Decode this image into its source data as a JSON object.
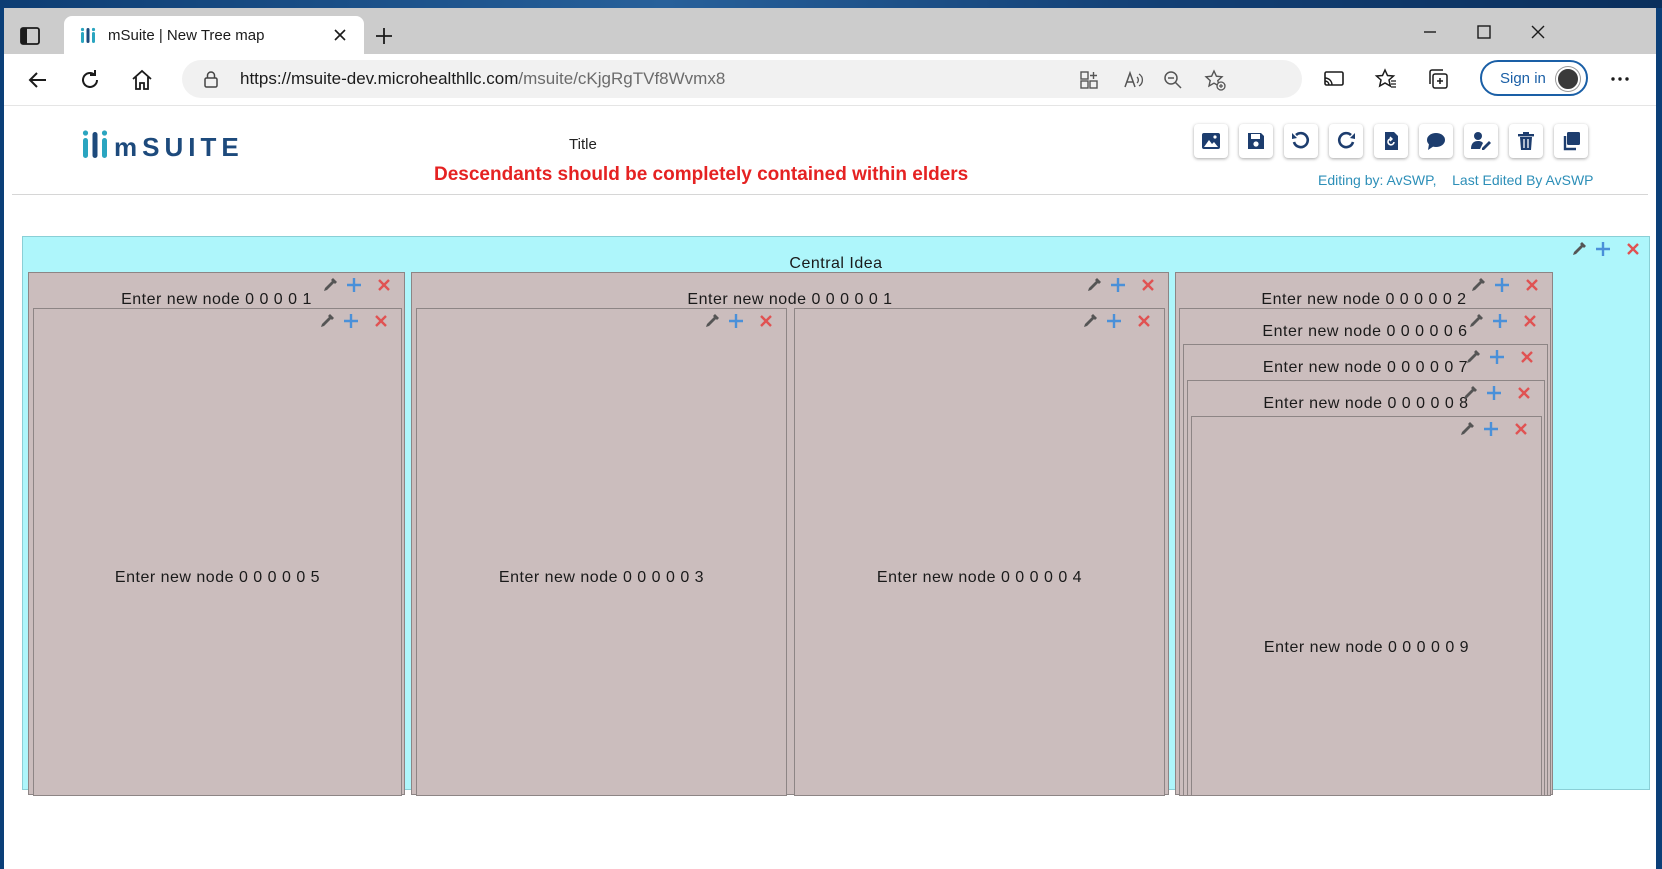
{
  "browser": {
    "tab_title": "mSuite | New Tree map",
    "url_host": "https://msuite-dev.microhealthllc.com",
    "url_path": "/msuite/cKjgRgTVf8Wvmx8",
    "signin_label": "Sign in"
  },
  "app": {
    "logo_text": "mSUITE",
    "title_label": "Title",
    "warning": "Descendants should be completely contained within elders",
    "editing_by": "Editing by: AvSWP,",
    "last_edited_by": "Last Edited By AvSWP",
    "brand_color": "#1d4a7c",
    "accent_color": "#2aa5c0"
  },
  "treemap": {
    "root_label": "Central Idea",
    "nodes": {
      "n1a": "Enter new node 0 0 0 0 1",
      "n5": "Enter new node 0 0 0 0 0 5",
      "n1b": "Enter new node 0 0 0 0 0 1",
      "n3": "Enter new node 0 0 0 0 0 3",
      "n4": "Enter new node 0 0 0 0 0 4",
      "n2": "Enter new node 0 0 0 0 0 2",
      "n6": "Enter new node 0 0 0 0 0 6",
      "n7": "Enter new node 0 0 0 0 0 7",
      "n8": "Enter new node 0 0 0 0 0 8",
      "n9": "Enter new node 0 0 0 0 0 9"
    },
    "root_color": "#aef6fb",
    "node_color": "#cbbdbd"
  }
}
